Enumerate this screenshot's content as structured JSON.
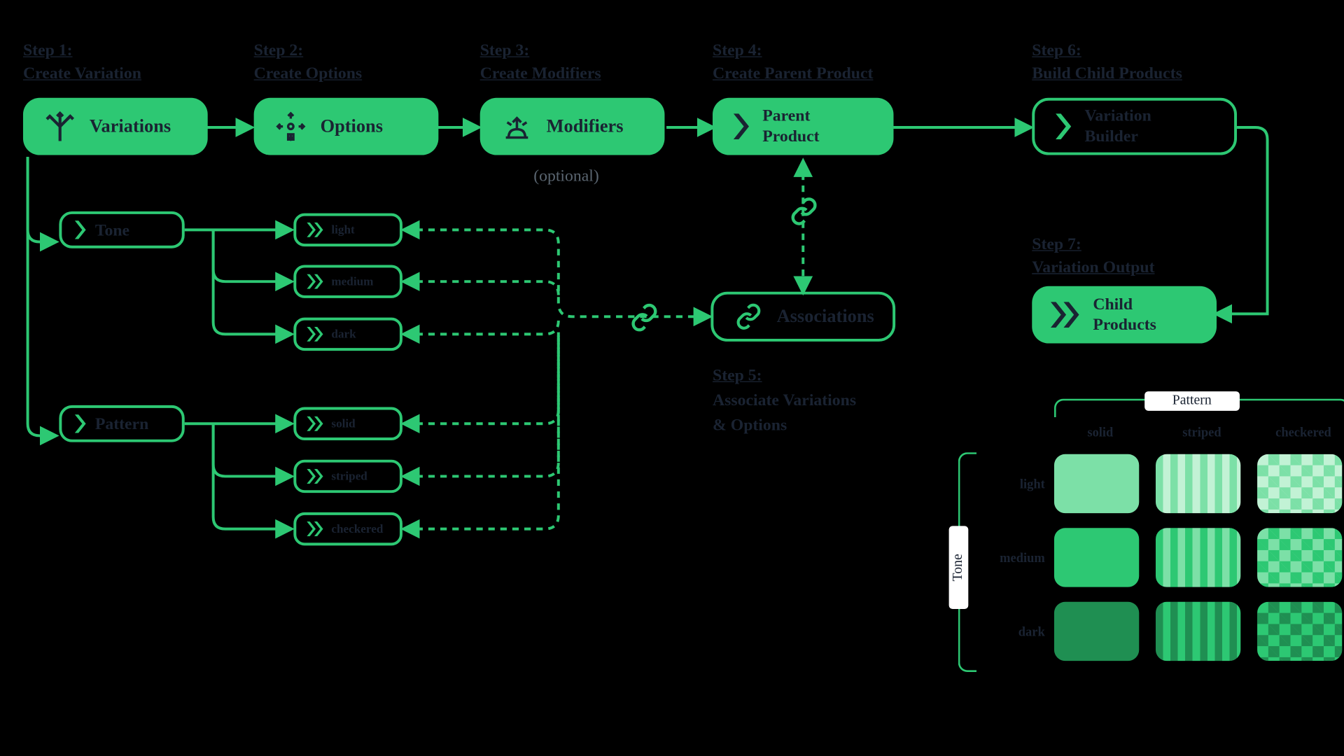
{
  "steps": {
    "s1": {
      "label_line1": "Step 1:",
      "label_line2": "Create Variation",
      "node": "Variations"
    },
    "s2": {
      "label_line1": "Step 2:",
      "label_line2": "Create Options",
      "node": "Options"
    },
    "s3": {
      "label_line1": "Step 3:",
      "label_line2": "Create Modifiers",
      "node": "Modifiers",
      "optional": "(optional)"
    },
    "s4": {
      "label_line1": "Step 4:",
      "label_line2": "Create Parent Product",
      "node_line1": "Parent",
      "node_line2": "Product"
    },
    "s5": {
      "label_line1": "Step 5:",
      "label_line2": "Associate Variations",
      "label_line3": "& Options",
      "node": "Associations"
    },
    "s6": {
      "label_line1": "Step 6:",
      "label_line2": "Build Child Products",
      "node_line1": "Variation",
      "node_line2": "Builder"
    },
    "s7": {
      "label_line1": "Step 7:",
      "label_line2_a": "Variation ",
      "label_line2_b": "Output",
      "node_line1": "Child",
      "node_line2": "Products"
    }
  },
  "variations": {
    "tone": {
      "name": "Tone",
      "options": [
        "light",
        "medium",
        "dark"
      ]
    },
    "pattern": {
      "name": "Pattern",
      "options": [
        "solid",
        "striped",
        "checkered"
      ]
    }
  },
  "matrix": {
    "axis_pattern": "Pattern",
    "axis_tone": "Tone",
    "cols": [
      "solid",
      "striped",
      "checkered"
    ],
    "rows": [
      "light",
      "medium",
      "dark"
    ]
  },
  "colors": {
    "accent": "#2dc873",
    "light": "#7ce0a7",
    "lighter": "#c2f2d5",
    "dark": "#1f8f52"
  }
}
